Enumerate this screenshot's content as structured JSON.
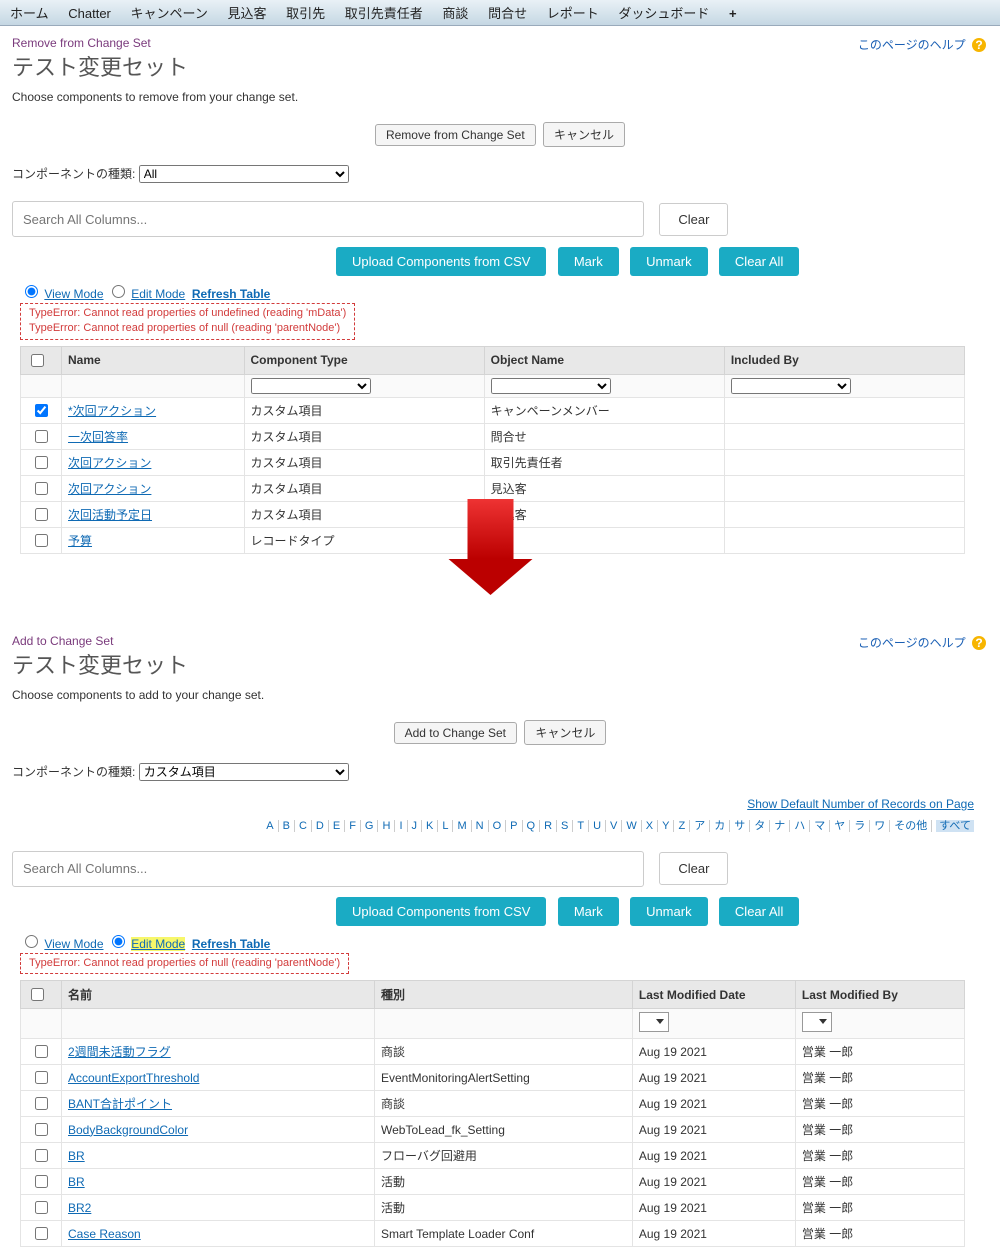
{
  "nav": {
    "tabs": [
      "ホーム",
      "Chatter",
      "キャンペーン",
      "見込客",
      "取引先",
      "取引先責任者",
      "商談",
      "問合せ",
      "レポート",
      "ダッシュボード"
    ],
    "plus": "+"
  },
  "help_label": "このページのヘルプ",
  "top": {
    "crumb": "Remove from Change Set",
    "title": "テスト変更セット",
    "desc": "Choose components to remove from your change set.",
    "primary_btn": "Remove from Change Set",
    "cancel_btn": "キャンセル",
    "comp_type_label": "コンポーネントの種類:",
    "comp_type_value": "All",
    "search_placeholder": "Search All Columns...",
    "clear_btn": "Clear",
    "teal_btns": {
      "upload": "Upload Components from CSV",
      "mark": "Mark",
      "unmark": "Unmark",
      "clearall": "Clear All"
    },
    "mode": {
      "view": "View Mode",
      "edit": "Edit Mode",
      "refresh": "Refresh Table",
      "view_selected": true
    },
    "errors": [
      "TypeError: Cannot read properties of undefined (reading 'mData')",
      "TypeError: Cannot read properties of null (reading 'parentNode')"
    ],
    "headers": {
      "name": "Name",
      "type": "Component Type",
      "obj": "Object Name",
      "inc": "Included By"
    },
    "rows": [
      {
        "checked": true,
        "name": "*次回アクション",
        "type": "カスタム項目",
        "obj": "キャンペーンメンバー"
      },
      {
        "checked": false,
        "name": "一次回答率",
        "type": "カスタム項目",
        "obj": "問合せ"
      },
      {
        "checked": false,
        "name": "次回アクション",
        "type": "カスタム項目",
        "obj": "取引先責任者"
      },
      {
        "checked": false,
        "name": "次回アクション",
        "type": "カスタム項目",
        "obj": "見込客"
      },
      {
        "checked": false,
        "name": "次回活動予定日",
        "type": "カスタム項目",
        "obj": "見込客"
      },
      {
        "checked": false,
        "name": "予算",
        "type": "レコードタイプ",
        "obj": "商"
      }
    ]
  },
  "bottom": {
    "crumb": "Add to Change Set",
    "title": "テスト変更セット",
    "desc": "Choose components to add to your change set.",
    "primary_btn": "Add to Change Set",
    "cancel_btn": "キャンセル",
    "comp_type_label": "コンポーネントの種類:",
    "comp_type_value": "カスタム項目",
    "records_link": "Show Default Number of Records on Page",
    "alpha": [
      "A",
      "B",
      "C",
      "D",
      "E",
      "F",
      "G",
      "H",
      "I",
      "J",
      "K",
      "L",
      "M",
      "N",
      "O",
      "P",
      "Q",
      "R",
      "S",
      "T",
      "U",
      "V",
      "W",
      "X",
      "Y",
      "Z",
      "ア",
      "カ",
      "サ",
      "タ",
      "ナ",
      "ハ",
      "マ",
      "ヤ",
      "ラ",
      "ワ",
      "その他",
      "すべて"
    ],
    "alpha_selected": "すべて",
    "search_placeholder": "Search All Columns...",
    "clear_btn": "Clear",
    "teal_btns": {
      "upload": "Upload Components from CSV",
      "mark": "Mark",
      "unmark": "Unmark",
      "clearall": "Clear All"
    },
    "mode": {
      "view": "View Mode",
      "edit": "Edit Mode",
      "refresh": "Refresh Table",
      "edit_selected": true
    },
    "errors": [
      "TypeError: Cannot read properties of null (reading 'parentNode')"
    ],
    "headers": {
      "name": "名前",
      "type": "種別",
      "date": "Last Modified Date",
      "by": "Last Modified By"
    },
    "rows": [
      {
        "name": "2週間未活動フラグ",
        "type": "商談",
        "date": "Aug 19 2021",
        "by": "営業 一郎"
      },
      {
        "name": "AccountExportThreshold",
        "type": "EventMonitoringAlertSetting",
        "date": "Aug 19 2021",
        "by": "営業 一郎"
      },
      {
        "name": "BANT合計ポイント",
        "type": "商談",
        "date": "Aug 19 2021",
        "by": "営業 一郎"
      },
      {
        "name": "BodyBackgroundColor",
        "type": "WebToLead_fk_Setting",
        "date": "Aug 19 2021",
        "by": "営業 一郎"
      },
      {
        "name": "BR",
        "type": "フローバグ回避用",
        "date": "Aug 19 2021",
        "by": "営業 一郎"
      },
      {
        "name": "BR",
        "type": "活動",
        "date": "Aug 19 2021",
        "by": "営業 一郎"
      },
      {
        "name": "BR2",
        "type": "活動",
        "date": "Aug 19 2021",
        "by": "営業 一郎"
      },
      {
        "name": "Case Reason",
        "type": "Smart Template Loader Conf",
        "date": "Aug 19 2021",
        "by": "営業 一郎"
      }
    ]
  }
}
